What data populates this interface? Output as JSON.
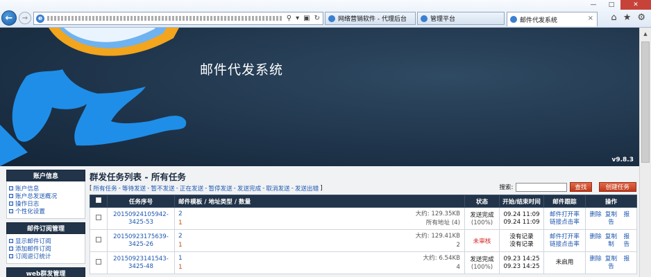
{
  "browser": {
    "tabs": [
      {
        "label": "网络营销软件 - 代理后台",
        "active": false
      },
      {
        "label": "管理平台",
        "active": false
      },
      {
        "label": "邮件代发系统",
        "active": true
      }
    ],
    "win_min": "—",
    "win_max": "□",
    "win_close": "✕"
  },
  "banner": {
    "title": "邮件代发系统",
    "version": "v9.8.3"
  },
  "sidebar": {
    "sections": [
      {
        "title": "账户信息",
        "items": [
          "账户信息",
          "账户总发送概况",
          "操作日志",
          "个性化设置"
        ]
      },
      {
        "title": "邮件订阅管理",
        "items": [
          "显示邮件订阅",
          "添加邮件订阅",
          "订阅退订统计"
        ]
      },
      {
        "title": "web群发管理",
        "items": []
      }
    ]
  },
  "main": {
    "title": "群发任务列表 - 所有任务",
    "filters": [
      "所有任务",
      "等待发送",
      "暂不发送",
      "正在发送",
      "暂停发送",
      "发送完成",
      "取消发送",
      "发送出错"
    ],
    "search_label": "搜索:",
    "search_placeholder": "",
    "search_button": "查找",
    "create_button": "创建任务"
  },
  "table": {
    "headers": [
      "任务序号",
      "邮件模板 / 地址类型 / 数量",
      "状态",
      "开始/结束时间",
      "邮件跟踪",
      "操作"
    ],
    "rows": [
      {
        "id1": "20150924105942-",
        "id2": "3425-53",
        "tmpl1": "2",
        "tmpl2": "1",
        "size": "大约: 129.35KB",
        "addr": "所有地址 (4)",
        "status1": "发送完成",
        "status2": "(100%)",
        "status_red": "",
        "time1": "09.24 11:09",
        "time2": "09.24 11:09",
        "track1": "邮件打开率",
        "track2": "链接点击率",
        "ops": [
          "删除",
          "复制",
          "报",
          "",
          "告",
          ""
        ]
      },
      {
        "id1": "20150923175639-",
        "id2": "3425-26",
        "tmpl1": "2",
        "tmpl2": "1",
        "size": "大约: 129.41KB",
        "addr": "2",
        "status1": "",
        "status2": "",
        "status_red": "未审核",
        "time1": "没有记录",
        "time2": "没有记录",
        "track1": "邮件打开率",
        "track2": "链接点击率",
        "ops": [
          "删除",
          "复制",
          "报",
          "",
          "制",
          "告"
        ]
      },
      {
        "id1": "20150923141543-",
        "id2": "3425-48",
        "tmpl1": "1",
        "tmpl2": "1",
        "size": "大约: 6.54KB",
        "addr": "4",
        "status1": "发送完成",
        "status2": "(100%)",
        "status_red": "",
        "time1": "09.23 14:25",
        "time2": "09.23 14:25",
        "track1": "未启用",
        "track2": "",
        "ops": [
          "删除",
          "复制",
          "报",
          "",
          "告",
          ""
        ]
      }
    ]
  },
  "colors": {
    "banner_bg": "#1e3349",
    "header_bg": "#223449",
    "link": "#1d56b0",
    "button_red": "#c0391c",
    "status_red": "#d42323"
  },
  "icons": [
    "back-arrow-icon",
    "forward-arrow-icon",
    "ie-icon",
    "search-icon",
    "refresh-icon",
    "home-icon",
    "star-icon",
    "gear-icon"
  ]
}
